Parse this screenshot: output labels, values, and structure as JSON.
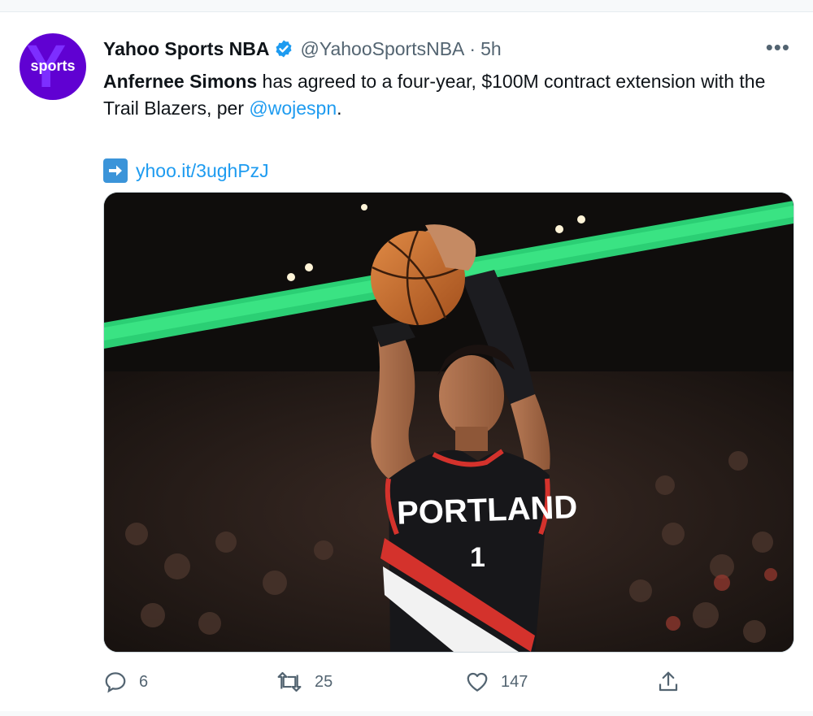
{
  "author": {
    "avatar_label": "sports",
    "display_name": "Yahoo Sports NBA",
    "handle": "@YahooSportsNBA",
    "separator": "·",
    "time": "5h",
    "verified_icon": "verified-badge-icon",
    "brand_color": "#6001d2"
  },
  "tweet": {
    "text_bold": "Anfernee Simons",
    "text_part1": " has agreed to a four-year, $100M contract extension with the Trail Blazers, per ",
    "mention": "@wojespn",
    "text_end": ".",
    "link_icon": "right-arrow-emoji-icon",
    "link": "yhoo.it/3ughPzJ"
  },
  "media": {
    "jersey_text": "PORTLAND",
    "jersey_number": "1"
  },
  "actions": {
    "reply_count": "6",
    "retweet_count": "25",
    "like_count": "147",
    "reply_icon": "reply-icon",
    "retweet_icon": "retweet-icon",
    "like_icon": "heart-icon",
    "share_icon": "share-icon"
  },
  "menu_icon": "more-options-icon",
  "accent_color": "#1d9bf0"
}
